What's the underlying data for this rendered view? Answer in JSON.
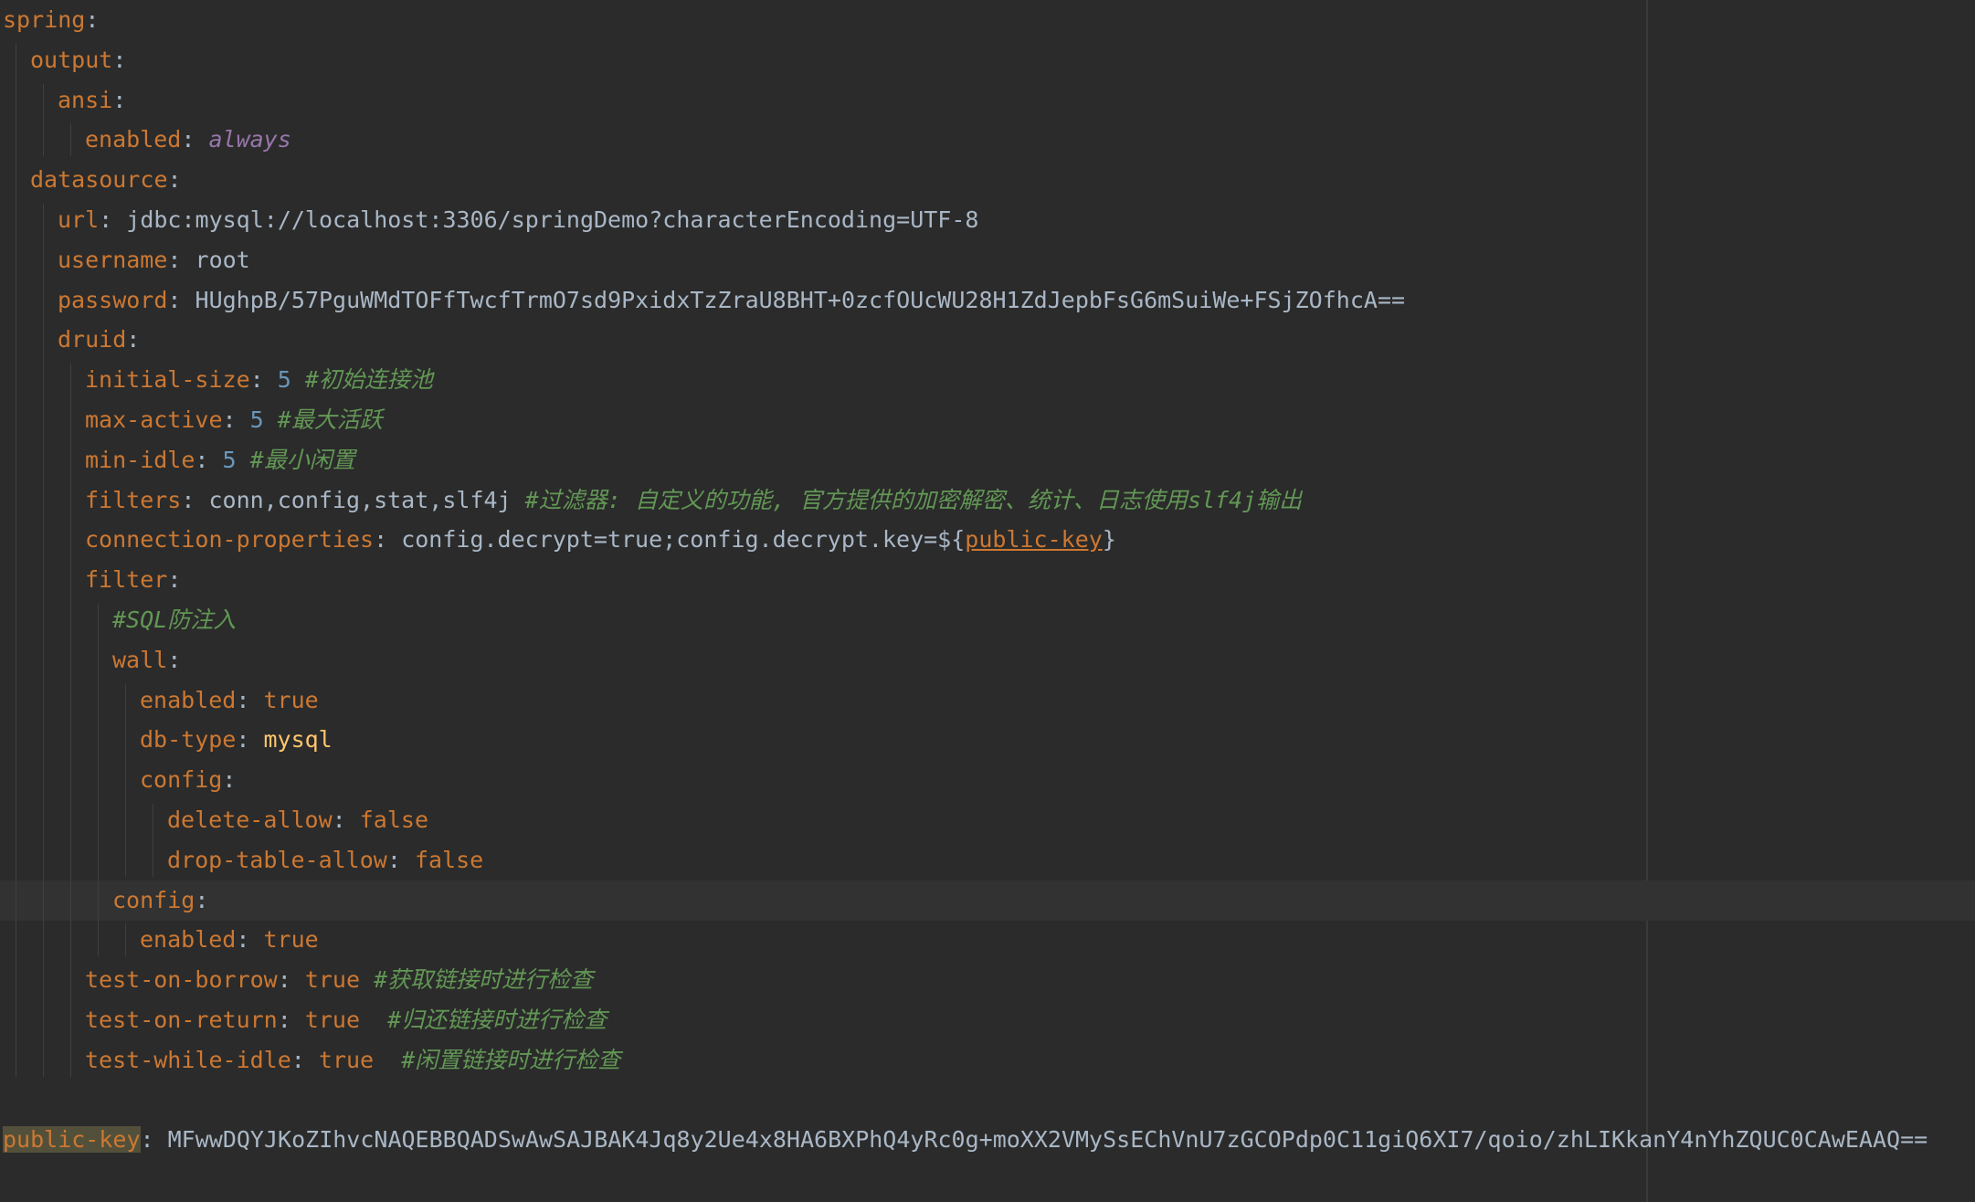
{
  "editor": {
    "lines": [
      {
        "indent": 0,
        "key": "spring",
        "value": ""
      },
      {
        "indent": 1,
        "key": "output",
        "value": ""
      },
      {
        "indent": 2,
        "key": "ansi",
        "value": ""
      },
      {
        "indent": 3,
        "key": "enabled",
        "value": "always",
        "value_style": "alias"
      },
      {
        "indent": 1,
        "key": "datasource",
        "value": ""
      },
      {
        "indent": 2,
        "key": "url",
        "value": "jdbc:mysql://localhost:3306/springDemo?characterEncoding=UTF-8",
        "value_style": "v"
      },
      {
        "indent": 2,
        "key": "username",
        "value": "root",
        "value_style": "v"
      },
      {
        "indent": 2,
        "key": "password",
        "value": "HUghpB/57PguWMdTOFfTwcfTrmO7sd9PxidxTzZraU8BHT+0zcfOUcWU28H1ZdJepbFsG6mSuiWe+FSjZOfhcA==",
        "value_style": "v"
      },
      {
        "indent": 2,
        "key": "druid",
        "value": ""
      },
      {
        "indent": 3,
        "key": "initial-size",
        "value": "5",
        "value_style": "num",
        "comment": "#初始连接池"
      },
      {
        "indent": 3,
        "key": "max-active",
        "value": "5",
        "value_style": "num",
        "comment": "#最大活跃"
      },
      {
        "indent": 3,
        "key": "min-idle",
        "value": "5",
        "value_style": "num",
        "comment": "#最小闲置"
      },
      {
        "indent": 3,
        "key": "filters",
        "value": "conn,config,stat,slf4j",
        "value_style": "v",
        "comment": "#过滤器: 自定义的功能, 官方提供的加密解密、统计、日志使用slf4j输出"
      },
      {
        "indent": 3,
        "key": "connection-properties",
        "value": "config.decrypt=true;config.decrypt.key=${",
        "value_style": "v",
        "ref": "public-key",
        "value_tail": "}"
      },
      {
        "indent": 3,
        "key": "filter",
        "value": ""
      },
      {
        "indent": 4,
        "key": "",
        "value": "",
        "comment": "#SQL防注入"
      },
      {
        "indent": 4,
        "key": "wall",
        "value": ""
      },
      {
        "indent": 5,
        "key": "enabled",
        "value": "true",
        "value_style": "bool"
      },
      {
        "indent": 5,
        "key": "db-type",
        "value": "mysql",
        "value_style": "yel"
      },
      {
        "indent": 5,
        "key": "config",
        "value": ""
      },
      {
        "indent": 6,
        "key": "delete-allow",
        "value": "false",
        "value_style": "bool"
      },
      {
        "indent": 6,
        "key": "drop-table-allow",
        "value": "false",
        "value_style": "bool"
      },
      {
        "indent": 4,
        "key": "config",
        "value": "",
        "current": true
      },
      {
        "indent": 5,
        "key": "enabled",
        "value": "true",
        "value_style": "bool"
      },
      {
        "indent": 3,
        "key": "test-on-borrow",
        "value": "true",
        "value_style": "bool",
        "comment": "#获取链接时进行检查"
      },
      {
        "indent": 3,
        "key": "test-on-return",
        "value": "true",
        "value_style": "bool",
        "comment": " #归还链接时进行检查"
      },
      {
        "indent": 3,
        "key": "test-while-idle",
        "value": "true",
        "value_style": "bool",
        "comment": " #闲置链接时进行检查"
      },
      {
        "indent": 0,
        "key": "",
        "value": ""
      },
      {
        "indent": 0,
        "key": "public-key",
        "value": "MFwwDQYJKoZIhvcNAQEBBQADSwAwSAJBAK4Jq8y2Ue4x8HA6BXPhQ4yRc0g+moXX2VMySsEChVnU7zGCOPdp0C11giQ6XI7/qoio/zhLIKkanY4nYhZQUC0CAwEAAQ==",
        "value_style": "v",
        "highlight_key": true
      }
    ]
  }
}
